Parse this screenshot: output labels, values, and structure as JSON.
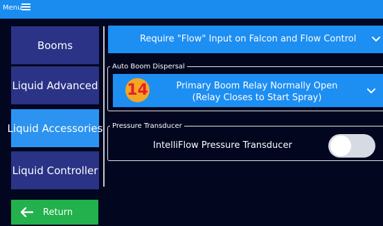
{
  "topbar": {
    "menu_label": "Menu"
  },
  "sidebar": {
    "items": [
      {
        "label": "Booms",
        "active": false
      },
      {
        "label": "Liquid Advanced",
        "active": false
      },
      {
        "label": "Liquid Accessories",
        "active": true
      },
      {
        "label": "Liquid Controller",
        "active": false
      }
    ],
    "return_label": "Return"
  },
  "main": {
    "flow_select": {
      "value": "Require \"Flow\" Input on Falcon and Flow Control"
    },
    "auto_boom": {
      "legend": "Auto Boom Dispersal",
      "badge": "14",
      "line1": "Primary Boom Relay Normally Open",
      "line2": "(Relay Closes to Start Spray)"
    },
    "pressure": {
      "legend": "Pressure Transducer",
      "label": "IntelliFlow Pressure Transducer",
      "toggle_on": false
    }
  },
  "colors": {
    "background": "#02061e",
    "topbar": "#1a8cf0",
    "nav_inactive": "#2a3385",
    "nav_active": "#2c93f0",
    "select": "#1d8ef2",
    "return": "#22b14c",
    "badge": "#f4a623",
    "badge_text": "#e3202a"
  }
}
